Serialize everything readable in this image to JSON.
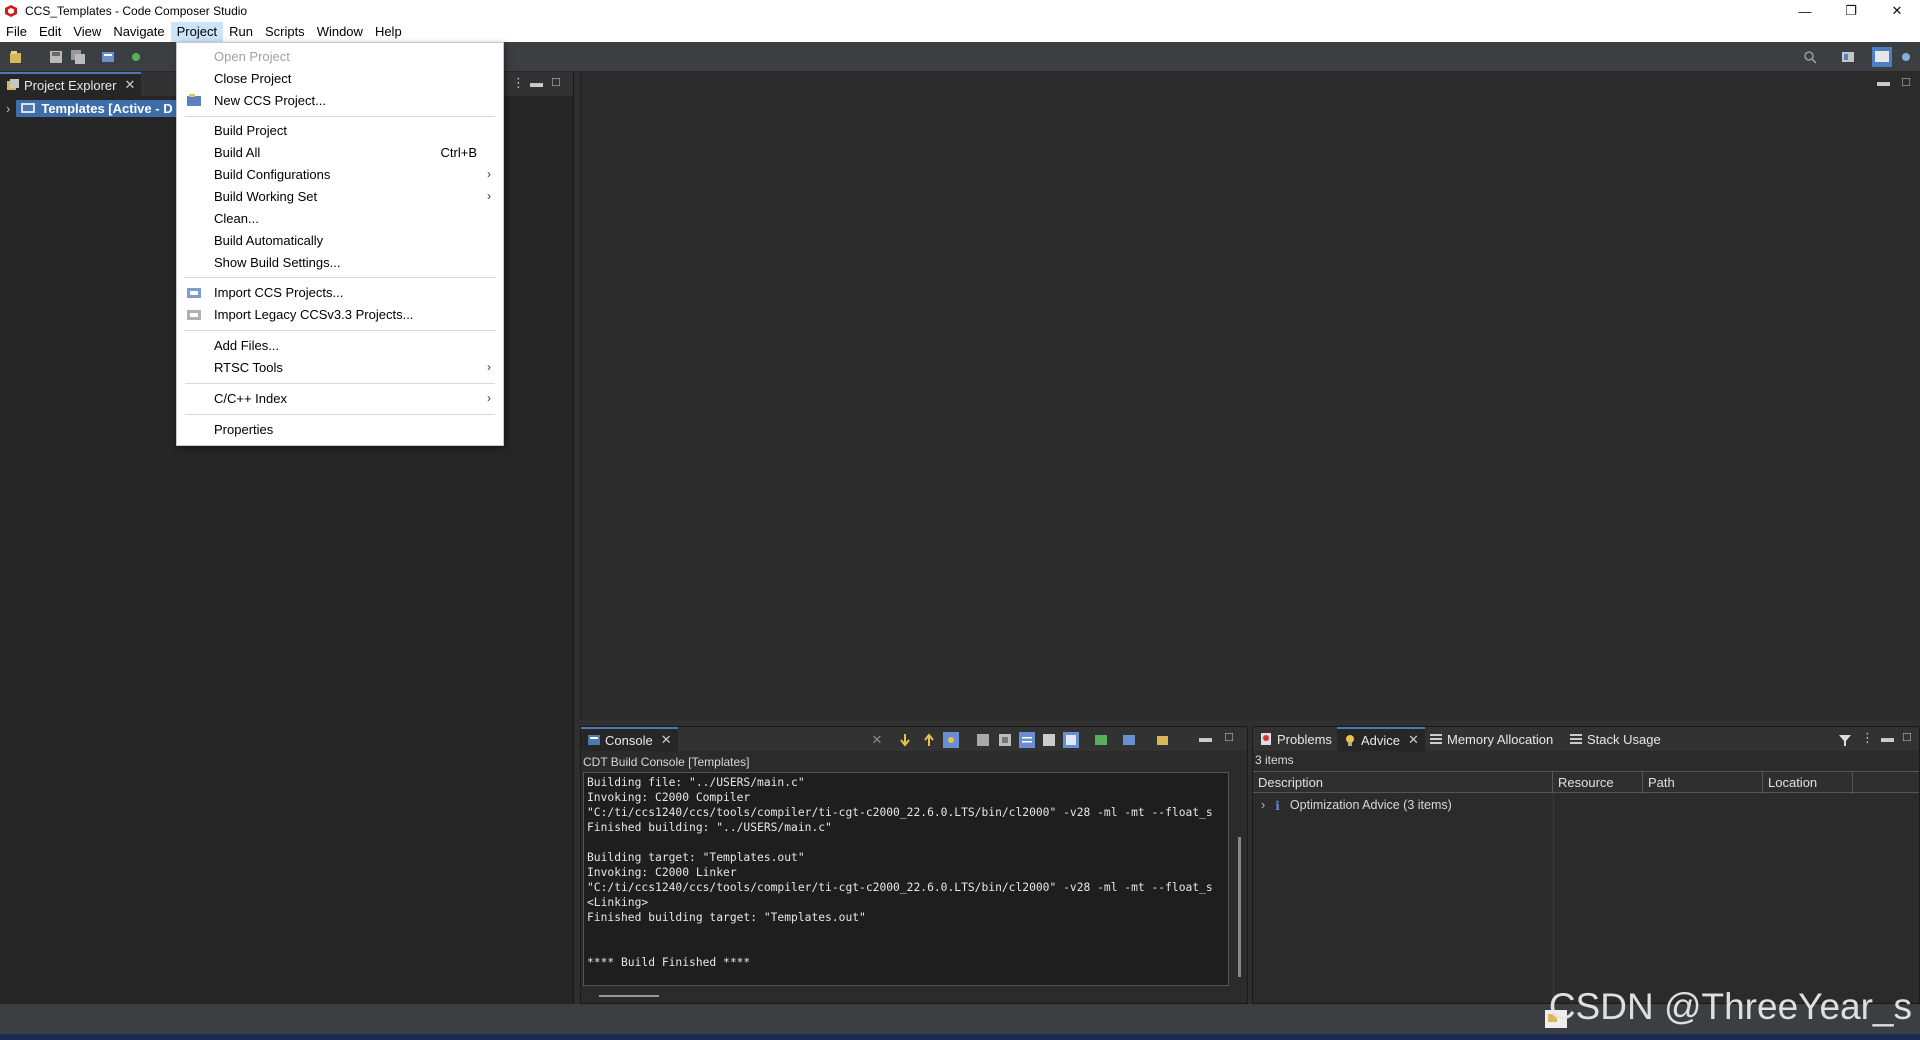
{
  "window": {
    "title": "CCS_Templates - Code Composer Studio",
    "minimize": "—",
    "restore": "❐",
    "close": "✕"
  },
  "menubar": [
    "File",
    "Edit",
    "View",
    "Navigate",
    "Project",
    "Run",
    "Scripts",
    "Window",
    "Help"
  ],
  "project_menu": {
    "items": [
      {
        "label": "Open Project",
        "disabled": true
      },
      {
        "label": "Close Project"
      },
      {
        "label": "New CCS Project...",
        "icon": "new-project-icon"
      },
      {
        "label": "Build Project"
      },
      {
        "label": "Build All",
        "shortcut": "Ctrl+B"
      },
      {
        "label": "Build Configurations",
        "submenu": "›"
      },
      {
        "label": "Build Working Set",
        "submenu": "›"
      },
      {
        "label": "Clean..."
      },
      {
        "label": "Build Automatically"
      },
      {
        "label": "Show Build Settings..."
      },
      {
        "label": "Import CCS Projects...",
        "icon": "import-icon"
      },
      {
        "label": "Import Legacy CCSv3.3 Projects...",
        "icon": "import-legacy-icon"
      },
      {
        "label": "Add Files..."
      },
      {
        "label": "RTSC Tools",
        "submenu": "›"
      },
      {
        "label": "C/C++ Index",
        "submenu": "›"
      },
      {
        "label": "Properties"
      }
    ]
  },
  "project_explorer": {
    "tab_label": "Project Explorer",
    "tree_item": "Templates  [Active - D"
  },
  "console": {
    "tab_label": "Console",
    "subtitle": "CDT Build Console [Templates]",
    "text": "Building file: \"../USERS/main.c\"\nInvoking: C2000 Compiler\n\"C:/ti/ccs1240/ccs/tools/compiler/ti-cgt-c2000_22.6.0.LTS/bin/cl2000\" -v28 -ml -mt --float_s\nFinished building: \"../USERS/main.c\"\n\nBuilding target: \"Templates.out\"\nInvoking: C2000 Linker\n\"C:/ti/ccs1240/ccs/tools/compiler/ti-cgt-c2000_22.6.0.LTS/bin/cl2000\" -v28 -ml -mt --float_s\n<Linking>\nFinished building target: \"Templates.out\"\n\n\n**** Build Finished ****"
  },
  "advice_panel": {
    "tabs": [
      "Problems",
      "Advice",
      "Memory Allocation",
      "Stack Usage"
    ],
    "count": "3 items",
    "columns": [
      "Description",
      "Resource",
      "Path",
      "Location"
    ],
    "rows": [
      {
        "description": "Optimization Advice (3 items)"
      }
    ]
  },
  "watermark": "CSDN @ThreeYear_s",
  "colors": {
    "menu_active": "#cce4f7",
    "selection": "#3d6dab",
    "background": "#2b2b2b"
  }
}
